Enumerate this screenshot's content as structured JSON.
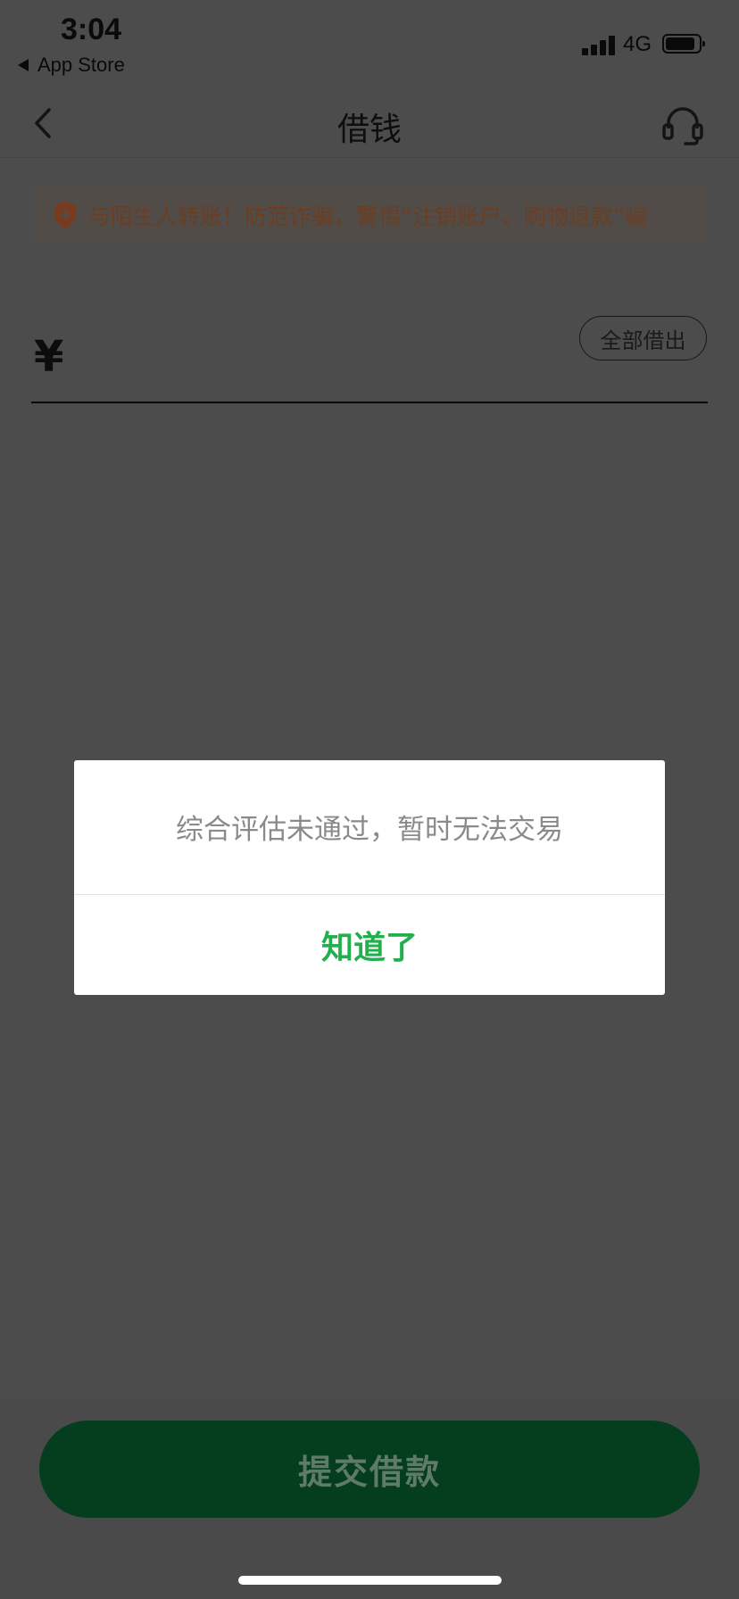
{
  "status_bar": {
    "time": "3:04",
    "back_app": "App Store",
    "network": "4G",
    "icons": {
      "signal": "signal-bars-icon",
      "battery": "battery-icon",
      "back": "back-triangle-icon"
    }
  },
  "nav": {
    "title": "借钱",
    "icons": {
      "back": "chevron-left-icon",
      "service": "headset-icon"
    }
  },
  "notice": {
    "text": "与陌生人转账！防范诈骗，警惕“注销账户、购物退款”骗",
    "icon": "shield-icon"
  },
  "amount": {
    "currency": "¥",
    "value": "",
    "borrow_all_label": "全部借出"
  },
  "submit": {
    "label": "提交借款"
  },
  "dialog": {
    "message": "综合评估未通过，暂时无法交易",
    "confirm_label": "知道了"
  },
  "colors": {
    "accent_green": "#22b04f",
    "submit_bg_dimmed": "#053d1f",
    "overlay": "#4c4c4c"
  }
}
